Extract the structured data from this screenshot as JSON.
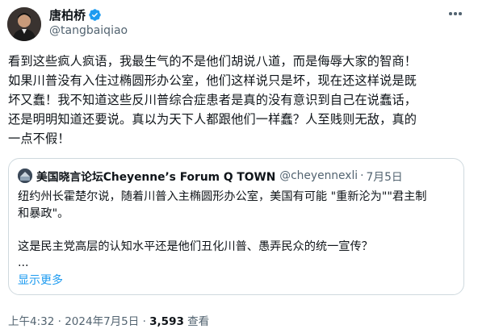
{
  "author": {
    "display_name": "唐柏桥",
    "handle": "@tangbaiqiao",
    "verified": true,
    "verified_color": "#1d9bf0"
  },
  "tweet": {
    "lines": [
      "看到这些疯人疯语，我最生气的不是他们胡说八道，而是侮辱大家的智商！",
      "如果川普没有入住过椭圆形办公室，他们这样说只是坏，现在还这样说是既",
      "坏又蠢！我不知道这些反川普综合症患者是真的没有意识到自己在说蠢话，",
      "还是明明知道还要说。真以为天下人都跟他们一样蠢？人至贱则无敌，真的",
      "一点不假！"
    ]
  },
  "quote": {
    "display_name": "美国晓言论坛Cheyenne’s Forum Q TOWN",
    "handle": "@cheyennexli",
    "separator": "·",
    "date": "7月5日",
    "lines": [
      "纽约州长霍楚尔说，随着川普入主椭圆形办公室，美国有可能 \"重新沦为\"\"君主制",
      "和暴政\"。",
      "",
      "这是民主党高层的认知水平还是他们丑化川普、愚弄民众的统一宣传？",
      "..."
    ],
    "show_more": "显示更多"
  },
  "meta": {
    "time": "上午4:32",
    "separator": "·",
    "date": "2024年7月5日",
    "views_count": "3,593",
    "views_label": "查看"
  },
  "icons": {
    "verified": "verified-badge-icon",
    "more": "more-options-icon"
  },
  "colors": {
    "accent": "#1d9bf0",
    "text": "#0f1419",
    "secondary": "#536471",
    "border": "#cfd9de"
  }
}
